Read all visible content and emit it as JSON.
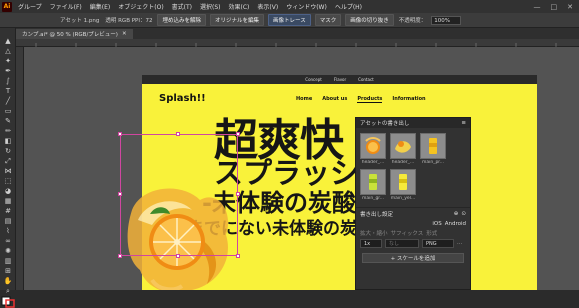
{
  "menubar": {
    "app_icon": "Ai",
    "items": [
      "グループ",
      "ファイル(F)",
      "編集(E)",
      "オブジェクト(O)",
      "書式(T)",
      "選択(S)",
      "効果(C)",
      "表示(V)",
      "ウィンドウ(W)",
      "ヘルプ(H)"
    ],
    "window_controls": [
      "—",
      "□",
      "✕"
    ]
  },
  "controlbar": {
    "asset_name": "アセット 1.png",
    "color_mode": "透明 RGB  PPI：72",
    "embed_release": "埋め込みを解除",
    "edit_original": "オリジナルを編集",
    "image_trace": "画像トレース",
    "mask": "マスク",
    "crop_image": "画像の切り抜き",
    "opacity_label": "不透明度：",
    "opacity_value": "100%"
  },
  "document_tab": {
    "title": "カンプ.ai* @ 50 % (RGB/プレビュー)",
    "close": "✕"
  },
  "artboard": {
    "top_links": [
      "Concept",
      "Flavor",
      "Contact"
    ],
    "logo": "Splash!!",
    "nav": [
      "Home",
      "About us",
      "Products",
      "Information"
    ],
    "active_nav": "Products",
    "headline_line1": "超爽快",
    "headline_line2": "スプラッシュ",
    "headline_line3": "-未体験の炭酸飲",
    "headline_line4": "今までにない未体験の炭酸"
  },
  "asset_panel": {
    "title": "アセットの書き出し",
    "menu_icon": "≡",
    "assets": [
      {
        "name": "header_..."
      },
      {
        "name": "header_..."
      },
      {
        "name": "main_pr..."
      },
      {
        "name": "main_gr..."
      },
      {
        "name": "main_yel..."
      }
    ],
    "export_settings_label": "書き出し設定",
    "platform_ios": "iOS",
    "platform_android": "Android",
    "scale_label": "拡大・縮小",
    "suffix_label": "サフィックス",
    "format_label": "形式",
    "scale_value": "1x",
    "suffix_value": "なし",
    "format_value": "PNG",
    "add_scale_label": "+ スケールを追加"
  },
  "colors": {
    "artboard_yellow": "#f9f23a",
    "selection_magenta": "#d046a0",
    "ui_dark": "#323232"
  }
}
